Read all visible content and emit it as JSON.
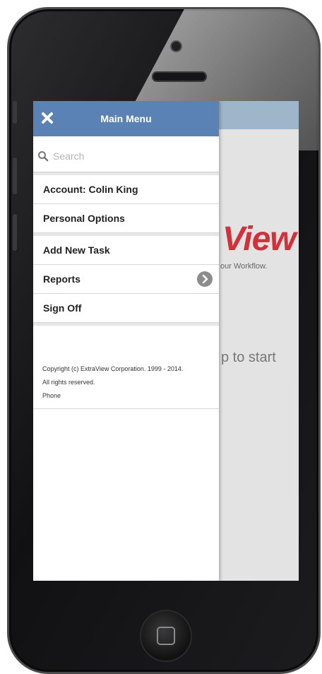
{
  "menu": {
    "title": "Main Menu",
    "search_placeholder": "Search",
    "items": [
      {
        "label": "Account:  Colin King"
      },
      {
        "label": "Personal Options"
      },
      {
        "label": "Add New Task"
      },
      {
        "label": "Reports",
        "icon": "chevron-right-icon"
      },
      {
        "label": "Sign Off"
      }
    ]
  },
  "footer": {
    "copyright": "Copyright (c) ExtraView Corporation. 1999 - 2014.",
    "rights": "All rights reserved.",
    "device": "Phone"
  },
  "background": {
    "logo_fragment": "View",
    "tagline_fragment": "our Workflow.",
    "start_fragment": "p to start"
  },
  "colors": {
    "header": "#5b82b4",
    "logo": "#d0313a"
  }
}
